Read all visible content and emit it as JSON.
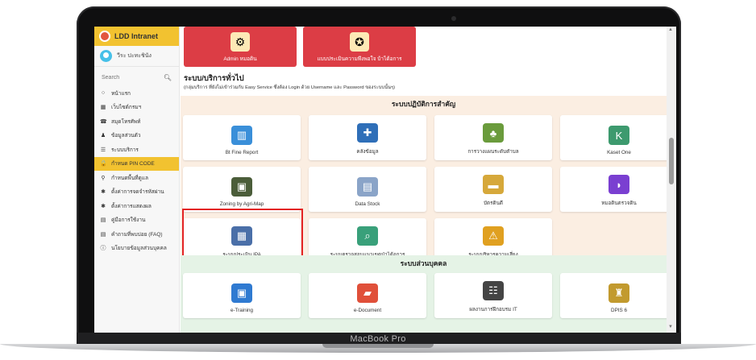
{
  "device": {
    "label": "MacBook Pro"
  },
  "sidebar": {
    "brand": "LDD Intranet",
    "user": "วีระ ปะทะชินัง",
    "search_placeholder": "Search",
    "items": [
      {
        "icon": "circle-icon",
        "glyph": "○",
        "label": "หน้าแรก"
      },
      {
        "icon": "website-icon",
        "glyph": "▦",
        "label": "เว็บไซต์กรมฯ"
      },
      {
        "icon": "phone-icon",
        "glyph": "☎",
        "label": "สมุดโทรศัพท์"
      },
      {
        "icon": "user-icon",
        "glyph": "♟",
        "label": "ข้อมูลส่วนตัว"
      },
      {
        "icon": "list-icon",
        "glyph": "☰",
        "label": "ระบบบริการ"
      },
      {
        "icon": "lock-icon",
        "glyph": "🔒",
        "label": "กำหนด PIN CODE",
        "active": true
      },
      {
        "icon": "pin-icon",
        "glyph": "⚲",
        "label": "กำหนดพื้นที่ดูแล"
      },
      {
        "icon": "gear-icon",
        "glyph": "✱",
        "label": "ตั้งค่าการจดจำรหัสผ่าน"
      },
      {
        "icon": "gear-icon",
        "glyph": "✱",
        "label": "ตั้งค่าการแสดงผล"
      },
      {
        "icon": "book-icon",
        "glyph": "▤",
        "label": "คู่มือการใช้งาน"
      },
      {
        "icon": "book-icon",
        "glyph": "▤",
        "label": "คำถามที่พบบ่อย (FAQ)"
      },
      {
        "icon": "info-icon",
        "glyph": "ⓘ",
        "label": "นโยบายข้อมูลส่วนบุคคล"
      }
    ]
  },
  "top_cards": [
    {
      "label": "Admin หมอดิน",
      "icon": "admin-icon",
      "glyph": "⚙"
    },
    {
      "label": "แบบประเมินความพึงพอใจ บ้าได้อการ",
      "icon": "emblem-icon",
      "glyph": "✪"
    }
  ],
  "section": {
    "title": "ระบบ/บริการทั่วไป",
    "subtitle": "(กลุ่มบริการ ที่ยังไม่เข้าร่วมกับ Easy Service ซึ่งต้อง Login ด้วย Username และ Password ของระบบนั้นๆ)"
  },
  "group1": {
    "title": "ระบบปฏิบัติการสำคัญ",
    "cards": [
      {
        "label": "Bt Fine Report",
        "icon": "report-icon",
        "glyph": "▥",
        "color": "#3a8fd9"
      },
      {
        "label": "คลังข้อมูล",
        "icon": "database-icon",
        "glyph": "✚",
        "color": "#2f6fb8"
      },
      {
        "label": "การวางแผนระดับตำบล",
        "icon": "plant-icon",
        "glyph": "♣",
        "color": "#6a9b3c"
      },
      {
        "label": "Kaset One",
        "icon": "kaset-icon",
        "glyph": "K",
        "color": "#3d9a6e"
      },
      {
        "label": "Zoning by Agri-Map",
        "icon": "map-icon",
        "glyph": "▣",
        "color": "#4b5d3a"
      },
      {
        "label": "Data Stock",
        "icon": "document-icon",
        "glyph": "▤",
        "color": "#8aa4c8"
      },
      {
        "label": "บัตรดินดี",
        "icon": "card-icon",
        "glyph": "▬",
        "color": "#d6a83a"
      },
      {
        "label": "หมอดินตรวจดิน",
        "icon": "soil-icon",
        "glyph": "◗",
        "color": "#7a3fd1"
      },
      {
        "label": "ระบบประเมิน IPA",
        "icon": "ipa-icon",
        "glyph": "▦",
        "color": "#4a6fa8"
      },
      {
        "label": "ระบบตรวจสอบแนวเขตป่าได้อการ",
        "icon": "magnify-icon",
        "glyph": "⌕",
        "color": "#39a07a"
      },
      {
        "label": "ระบบบริหารความเสี่ยง",
        "icon": "risk-icon",
        "glyph": "⚠",
        "color": "#e0a020"
      }
    ]
  },
  "group2": {
    "title": "ระบบส่วนบุคคล",
    "cards": [
      {
        "label": "e-Training",
        "icon": "training-icon",
        "glyph": "▣",
        "color": "#2f7ad1"
      },
      {
        "label": "e-Document",
        "icon": "folder-icon",
        "glyph": "▰",
        "color": "#e0503a"
      },
      {
        "label": "ผลงานการฝึกอบรม IT",
        "icon": "team-icon",
        "glyph": "☷",
        "color": "#444444"
      },
      {
        "label": "DPIS 6",
        "icon": "dpis-icon",
        "glyph": "♜",
        "color": "#c29a2e"
      }
    ]
  },
  "colors": {
    "brand_yellow": "#f2c230",
    "top_card_red": "#dc3d45",
    "highlight_red": "#e32323"
  }
}
